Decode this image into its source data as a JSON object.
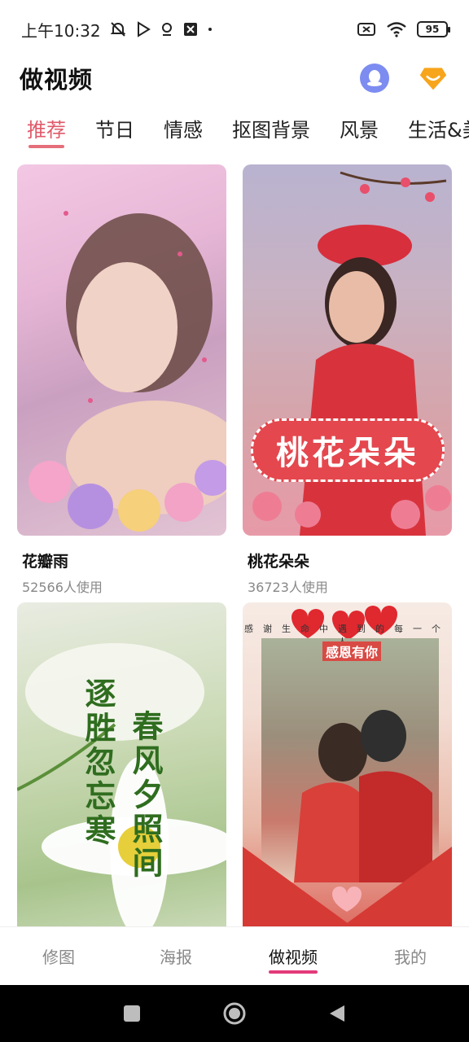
{
  "status_bar": {
    "time": "上午10:32",
    "battery": "95"
  },
  "header": {
    "title": "做视频"
  },
  "tabs": [
    {
      "label": "推荐",
      "active": true
    },
    {
      "label": "节日",
      "active": false
    },
    {
      "label": "情感",
      "active": false
    },
    {
      "label": "抠图背景",
      "active": false
    },
    {
      "label": "风景",
      "active": false
    },
    {
      "label": "生活&美",
      "active": false
    }
  ],
  "cards": [
    {
      "title": "花瓣雨",
      "usage": "52566人使用"
    },
    {
      "title": "桃花朵朵",
      "usage": "36723人使用",
      "banner": "桃花朵朵"
    },
    {
      "title": "",
      "usage": "",
      "poem_col1": "逐胜忽忘寒",
      "poem_col2": "春风夕照间"
    },
    {
      "title": "",
      "usage": "",
      "top_text": "感谢生命中遇到的每一个人",
      "badge": "感恩有你",
      "stamp": "感恩有你"
    }
  ],
  "bottom_nav": [
    {
      "label": "修图",
      "active": false
    },
    {
      "label": "海报",
      "active": false
    },
    {
      "label": "做视频",
      "active": true
    },
    {
      "label": "我的",
      "active": false
    }
  ],
  "colors": {
    "accent_tab": "#e05a6a",
    "nav_indicator": "#e23a7a"
  }
}
